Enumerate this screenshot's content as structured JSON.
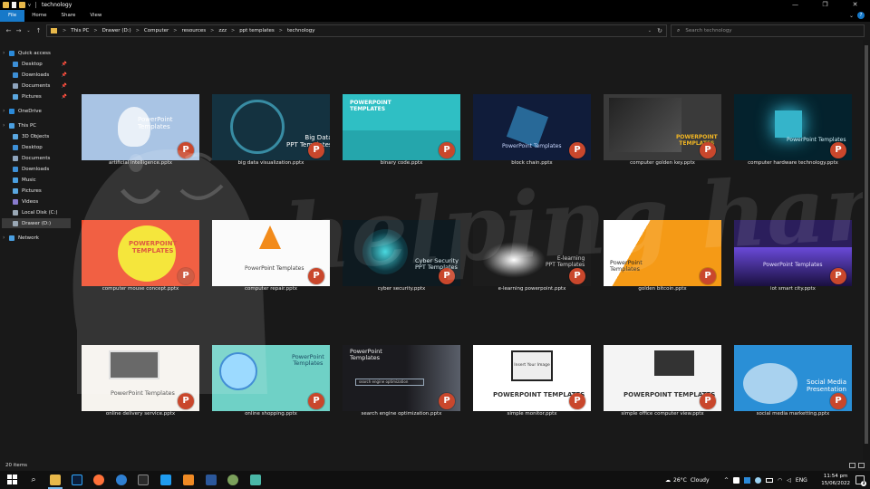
{
  "titlebar": {
    "title": "technology",
    "quick_access_more": "v"
  },
  "window_controls": {
    "minimize": "—",
    "maximize": "❐",
    "close": "✕"
  },
  "ribbon": {
    "tabs": [
      "File",
      "Home",
      "Share",
      "View"
    ],
    "expand": "⌄",
    "help": "?"
  },
  "nav": {
    "back": "←",
    "forward": "→",
    "recent": "⌄",
    "up": "↑"
  },
  "address": {
    "crumbs": [
      "This PC",
      "Drawer (D:)",
      "Computer",
      "resources",
      "zzz",
      "ppt templates",
      "technology"
    ],
    "separator": ">",
    "dropdown": "⌄",
    "refresh": "↻"
  },
  "search": {
    "placeholder": "Search technology",
    "icon": "⌕"
  },
  "sidebar": {
    "items": [
      {
        "label": "Quick access",
        "icon": "star-icon",
        "color": "#2b8ad9",
        "pinned": false
      },
      {
        "label": "Desktop",
        "icon": "desktop-icon",
        "color": "#3d8fd6",
        "pinned": true
      },
      {
        "label": "Downloads",
        "icon": "download-icon",
        "color": "#3d8fd6",
        "pinned": true
      },
      {
        "label": "Documents",
        "icon": "documents-icon",
        "color": "#8ea4bd",
        "pinned": true
      },
      {
        "label": "Pictures",
        "icon": "pictures-icon",
        "color": "#5aa7e0",
        "pinned": true
      },
      {
        "label": "OneDrive",
        "icon": "cloud-icon",
        "color": "#2b8ad9",
        "pinned": false
      },
      {
        "label": "This PC",
        "icon": "computer-icon",
        "color": "#4a9fe0",
        "pinned": false
      },
      {
        "label": "3D Objects",
        "icon": "cube-icon",
        "color": "#5aa7e0",
        "pinned": false
      },
      {
        "label": "Desktop",
        "icon": "desktop-icon",
        "color": "#3d8fd6",
        "pinned": false
      },
      {
        "label": "Documents",
        "icon": "documents-icon",
        "color": "#8ea4bd",
        "pinned": false
      },
      {
        "label": "Downloads",
        "icon": "download-icon",
        "color": "#3d8fd6",
        "pinned": false
      },
      {
        "label": "Music",
        "icon": "music-icon",
        "color": "#4a9fe0",
        "pinned": false
      },
      {
        "label": "Pictures",
        "icon": "pictures-icon",
        "color": "#5aa7e0",
        "pinned": false
      },
      {
        "label": "Videos",
        "icon": "video-icon",
        "color": "#8a7ccf",
        "pinned": false
      },
      {
        "label": "Local Disk (C:)",
        "icon": "disk-icon",
        "color": "#9aa8b5",
        "pinned": false
      },
      {
        "label": "Drawer (D:)",
        "icon": "disk-icon",
        "color": "#9aa8b5",
        "pinned": false,
        "selected": true
      },
      {
        "label": "Network",
        "icon": "network-icon",
        "color": "#4a9fe0",
        "pinned": false
      }
    ],
    "pin_glyph": "📌"
  },
  "files": [
    {
      "name": "artificial intelligence.pptx",
      "thumb_bg": "#a9c4e4",
      "thumb_text": "PowerPoint\nTemplates",
      "text_color": "#ffffff"
    },
    {
      "name": "big data visualization.pptx",
      "thumb_bg": "#143240",
      "thumb_text": "Big Data\nPPT Templates",
      "text_color": "#ffffff"
    },
    {
      "name": "binary code.pptx",
      "thumb_bg": "#2fbfc4",
      "thumb_text": "POWERPOINT\nTEMPLATES",
      "text_color": "#ffffff"
    },
    {
      "name": "block chain.pptx",
      "thumb_bg": "#101c3a",
      "thumb_text": "PowerPoint Templates",
      "text_color": "#c9d8ff"
    },
    {
      "name": "computer golden key.pptx",
      "thumb_bg": "#3a3a3a",
      "thumb_text": "POWERPOINT\nTEMPLATES",
      "text_color": "#f2b623"
    },
    {
      "name": "computer hardware technology.pptx",
      "thumb_bg": "#04222d",
      "thumb_text": "PowerPoint Templates",
      "text_color": "#cfeff7"
    },
    {
      "name": "computer mouse concept.pptx",
      "thumb_bg": "#f04a2a",
      "thumb_text": "POWERPOINT\nTEMPLATES",
      "text_color": "#d94026"
    },
    {
      "name": "computer repair.pptx",
      "thumb_bg": "#fbfbfb",
      "thumb_text": "PowerPoint Templates",
      "text_color": "#333333"
    },
    {
      "name": "cyber security.pptx",
      "thumb_bg": "#0e1a20",
      "thumb_text": "Cyber Security\nPPT Templates",
      "text_color": "#e0f0f5"
    },
    {
      "name": "e-learning powerpoint.pptx",
      "thumb_bg": "#1c1c1c",
      "thumb_text": "E-learning\nPPT Templates",
      "text_color": "#d2d2d2"
    },
    {
      "name": "golden bitcoin.pptx",
      "thumb_bg": "#f59a16",
      "thumb_text": "PowerPoint\nTemplates",
      "text_color": "#222222"
    },
    {
      "name": "iot smart city.pptx",
      "thumb_bg": "#2b1e5c",
      "thumb_text": "PowerPoint Templates",
      "text_color": "#e6e0ff"
    },
    {
      "name": "online delivery service.pptx",
      "thumb_bg": "#f6f3ee",
      "thumb_text": "PowerPoint Templates",
      "text_color": "#444444"
    },
    {
      "name": "online shopping.pptx",
      "thumb_bg": "#6fd1c6",
      "thumb_text": "PowerPoint\nTemplates",
      "text_color": "#1b4d63"
    },
    {
      "name": "search engine optimization.pptx",
      "thumb_bg": "#1b1b1f",
      "thumb_text": "PowerPoint\nTemplates",
      "text_color": "#f2f2f2"
    },
    {
      "name": "simple monitor.pptx",
      "thumb_bg": "#ffffff",
      "thumb_text": "POWERPOINT TEMPLATES",
      "text_color": "#333333"
    },
    {
      "name": "simple office computer view.pptx",
      "thumb_bg": "#f4f4f4",
      "thumb_text": "POWERPOINT TEMPLATES",
      "text_color": "#333333"
    },
    {
      "name": "social media marketting.pptx",
      "thumb_bg": "#2a8fd6",
      "thumb_text": "Social Media\nPresentation",
      "text_color": "#ffffff"
    }
  ],
  "powerpoint_badge": "P",
  "thumb_sub": {
    "monitor_screen": "Insert Your Image",
    "search_bar": "search engine optimization"
  },
  "status": {
    "count": "20 items"
  },
  "watermark": {
    "text": "helping hand"
  },
  "taskbar": {
    "start": "start-icon",
    "weather": {
      "temp": "26°C",
      "condition": "Cloudy"
    },
    "tray_caret": "^",
    "language": "ENG",
    "time": "11:54 pm",
    "date": "15/06/2022",
    "notifications": "3"
  }
}
